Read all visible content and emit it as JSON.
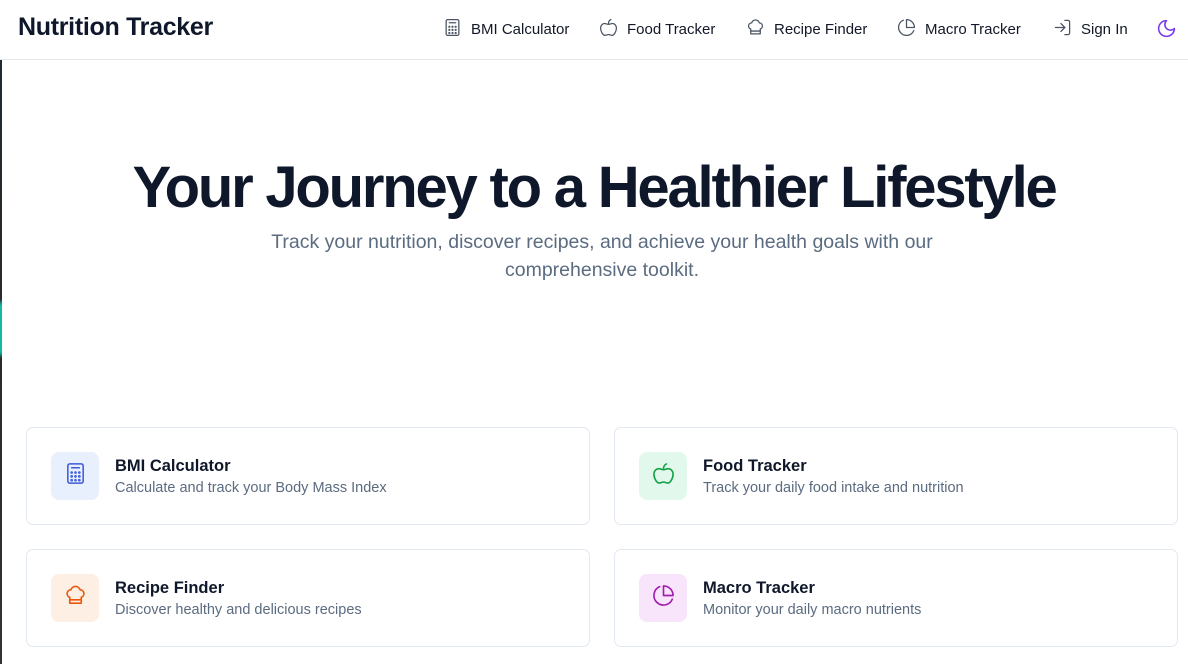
{
  "app": {
    "brand": "Nutrition Tracker"
  },
  "nav": {
    "items": [
      {
        "label": "BMI Calculator",
        "icon": "calculator-icon"
      },
      {
        "label": "Food Tracker",
        "icon": "apple-icon"
      },
      {
        "label": "Recipe Finder",
        "icon": "chef-hat-icon"
      },
      {
        "label": "Macro Tracker",
        "icon": "pie-chart-icon"
      },
      {
        "label": "Sign In",
        "icon": "sign-in-icon"
      }
    ],
    "theme_icon": "moon-icon"
  },
  "hero": {
    "title": "Your Journey to a Healthier Lifestyle",
    "subtitle": "Track your nutrition, discover recipes, and achieve your health goals with our comprehensive toolkit."
  },
  "features": [
    {
      "title": "BMI Calculator",
      "description": "Calculate and track your Body Mass Index",
      "icon": "calculator-icon",
      "accent": "#3b5bdb",
      "background": "#e8effd"
    },
    {
      "title": "Food Tracker",
      "description": "Track your daily food intake and nutrition",
      "icon": "apple-icon",
      "accent": "#16a34a",
      "background": "#e3f8ec"
    },
    {
      "title": "Recipe Finder",
      "description": "Discover healthy and delicious recipes",
      "icon": "chef-hat-icon",
      "accent": "#ea580c",
      "background": "#fdefe3"
    },
    {
      "title": "Macro Tracker",
      "description": "Monitor your daily macro nutrients",
      "icon": "pie-chart-icon",
      "accent": "#a21caf",
      "background": "#f8e4fb"
    }
  ],
  "colors": {
    "theme_toggle": "#7c3aed",
    "text_primary": "#0f172a",
    "text_muted": "#5b6b80"
  }
}
